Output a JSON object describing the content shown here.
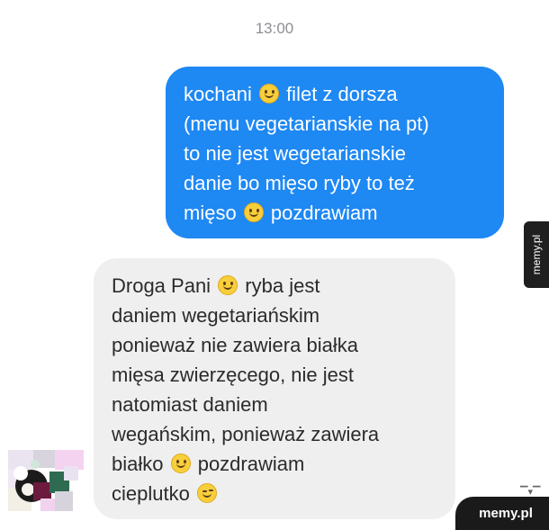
{
  "conversation": {
    "timestamp": "13:00",
    "outgoing_message": {
      "lines": [
        {
          "parts": [
            "kochani ",
            "{smile}",
            " filet z dorsza"
          ]
        },
        {
          "parts": [
            "(menu vegetarianskie na pt)"
          ]
        },
        {
          "parts": [
            "to nie jest wegetarianskie"
          ]
        },
        {
          "parts": [
            "danie bo mięso ryby to też"
          ]
        },
        {
          "parts": [
            "mięso ",
            "{smile}",
            " pozdrawiam"
          ]
        }
      ]
    },
    "incoming_message": {
      "lines": [
        {
          "parts": [
            "Droga Pani ",
            "{smile}",
            " ryba jest"
          ]
        },
        {
          "parts": [
            "daniem wegetariańskim"
          ]
        },
        {
          "parts": [
            "ponieważ nie zawiera białka"
          ]
        },
        {
          "parts": [
            "mięsa zwierzęcego, nie jest"
          ]
        },
        {
          "parts": [
            "natomiast daniem"
          ]
        },
        {
          "parts": [
            "wegańskim, ponieważ zawiera"
          ]
        },
        {
          "parts": [
            "białko ",
            "{smile}",
            " pozdrawiam"
          ]
        },
        {
          "parts": [
            "cieplutko ",
            "{wink}"
          ]
        }
      ]
    },
    "emoji_icons": {
      "smile": "slightly-smiling-face-icon",
      "wink": "winking-face-icon"
    },
    "colors": {
      "outgoing_bubble": "#1e88f3",
      "incoming_bubble": "#efefef"
    }
  },
  "watermarks": {
    "side_badge": "memy.pl",
    "bottom_badge": "memy.pl"
  }
}
